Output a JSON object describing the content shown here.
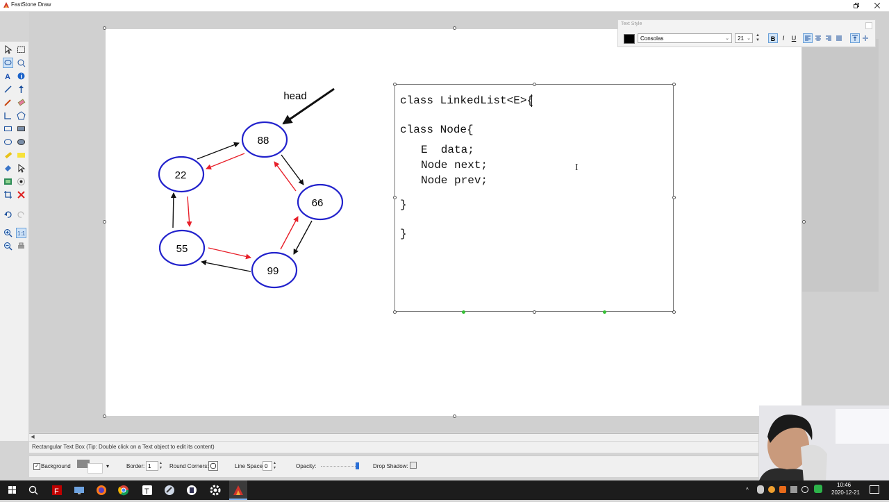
{
  "app": {
    "title": "FastStone Draw"
  },
  "diagram": {
    "head_label": "head",
    "nodes": [
      "88",
      "66",
      "99",
      "55",
      "22"
    ]
  },
  "code": {
    "lines": [
      "class LinkedList<E>{",
      "class Node{",
      "E  data;",
      "Node next;",
      "Node prev;",
      "}",
      "}"
    ]
  },
  "text_style": {
    "title": "Text Style",
    "font": "Consolas",
    "size": "21",
    "bold": "B",
    "italic": "I",
    "underline": "U"
  },
  "status": {
    "text": "Rectangular Text Box (Tip: Double click on a Text object to edit its content)"
  },
  "properties": {
    "background_label": "Background",
    "border_label": "Border:",
    "border_value": "1",
    "round_corners_label": "Round Corners:",
    "line_space_label": "Line Space:",
    "line_space_value": "0",
    "opacity_label": "Opacity:",
    "drop_shadow_label": "Drop Shadow:",
    "opacity_value": 1.0
  },
  "clock": {
    "time": "10:46",
    "date": "2020-12-21"
  },
  "colors": {
    "node_border": "#2222cc",
    "arrow_red": "#e8202a",
    "arrow_black": "#111111"
  }
}
